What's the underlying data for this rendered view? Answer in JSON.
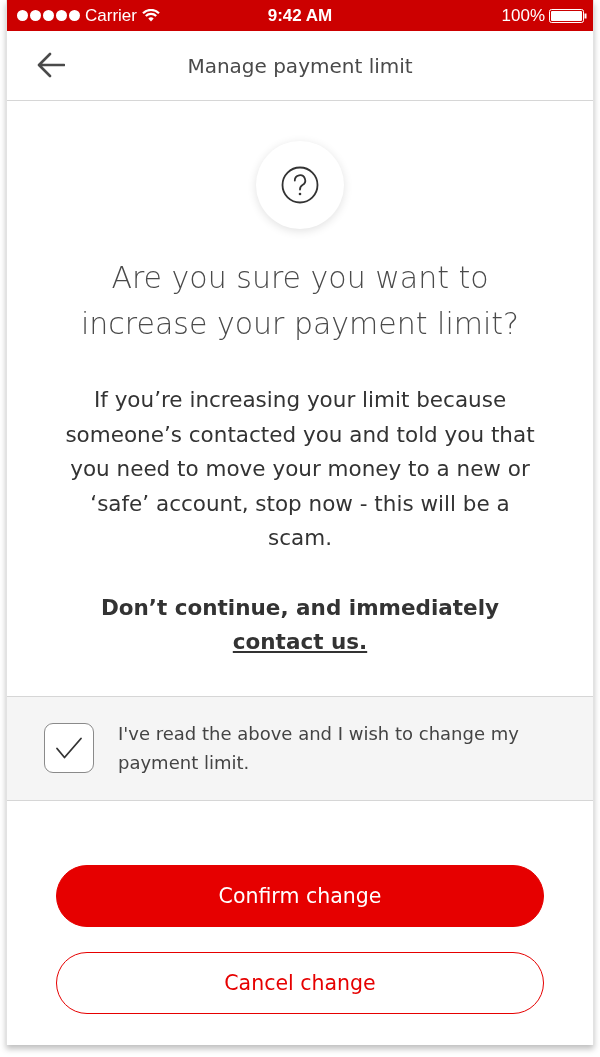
{
  "status_bar": {
    "carrier": "Carrier",
    "time": "9:42 AM",
    "battery": "100%"
  },
  "header": {
    "title": "Manage payment limit"
  },
  "prompt": {
    "heading": "Are you sure you want to increase your payment limit?",
    "body": "If you’re increasing your limit because someone’s contacted you and told you that you need to move your money to a new or ‘safe’ account, stop now - this will be a scam.",
    "warning": "Don’t continue, and immediately",
    "link": "contact us."
  },
  "consent": {
    "label": "I've read the above and I wish to change my payment limit.",
    "checked": true
  },
  "buttons": [
    {
      "label": "Confirm change",
      "kind": "primary"
    },
    {
      "label": "Cancel change",
      "kind": "secondary"
    }
  ]
}
